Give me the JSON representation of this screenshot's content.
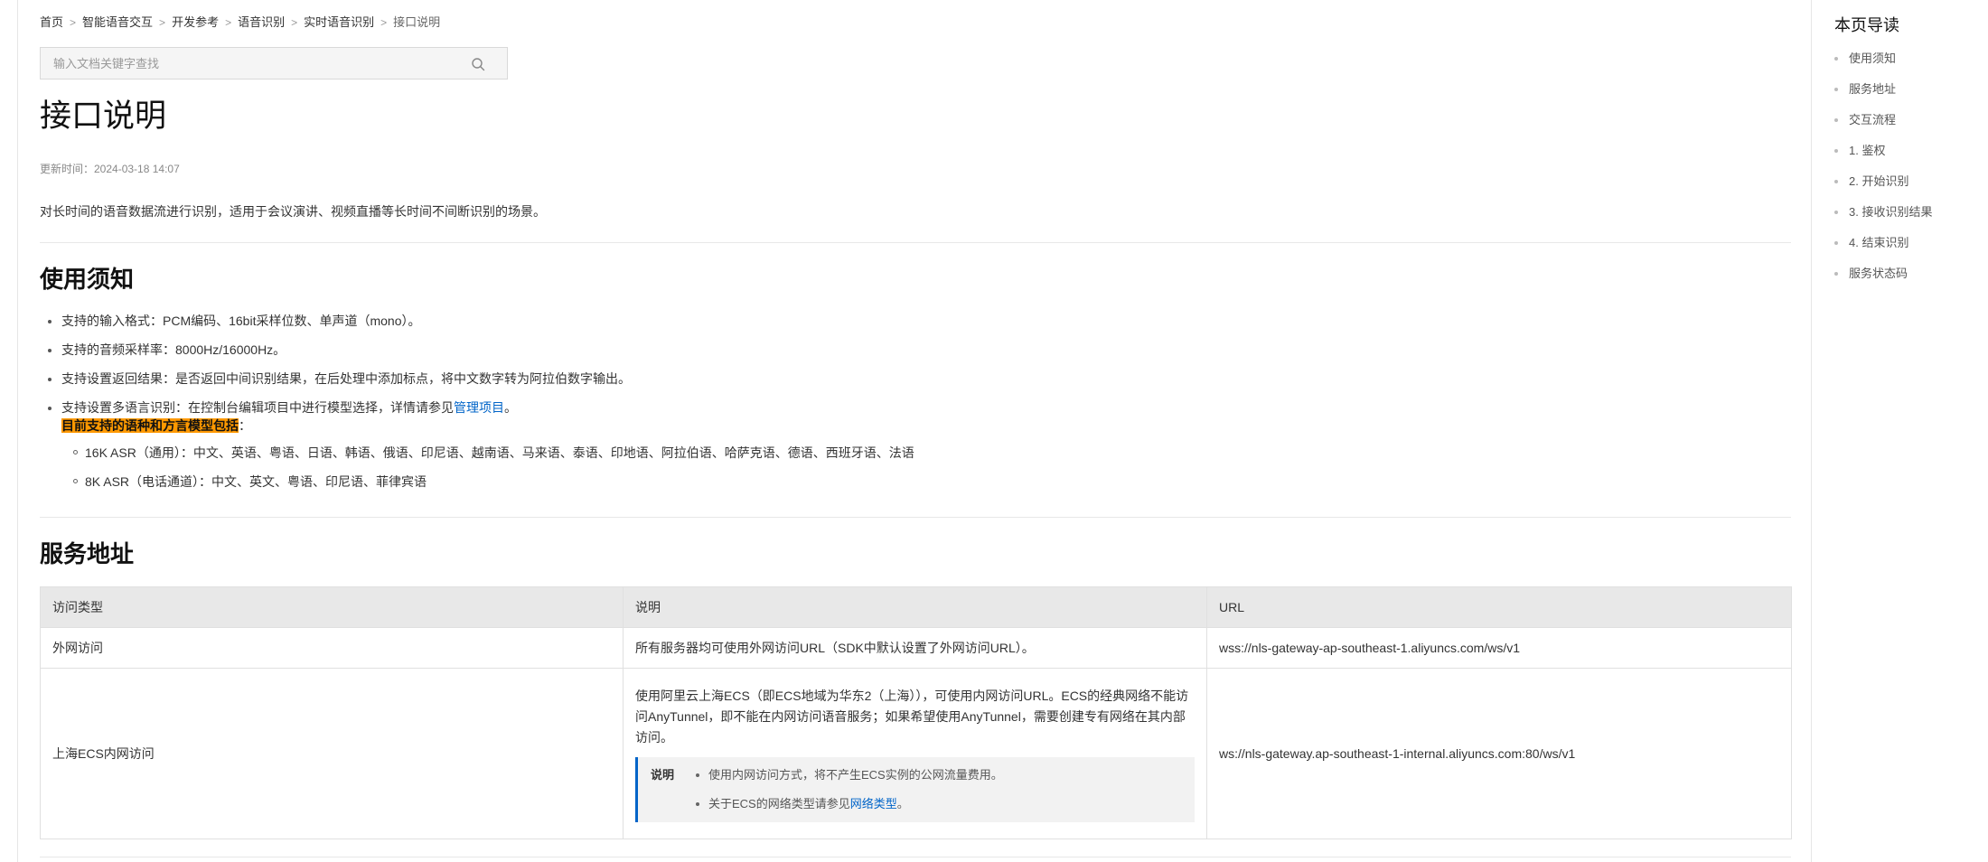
{
  "breadcrumb": [
    "首页",
    "智能语音交互",
    "开发参考",
    "语音识别",
    "实时语音识别",
    "接口说明"
  ],
  "search": {
    "placeholder": "输入文档关键字查找"
  },
  "page": {
    "title": "接口说明",
    "updated": "更新时间：2024-03-18 14:07",
    "intro": "对长时间的语音数据流进行识别，适用于会议演讲、视频直播等长时间不间断识别的场景。"
  },
  "usage": {
    "heading": "使用须知",
    "items": [
      "支持的输入格式：PCM编码、16bit采样位数、单声道（mono）。",
      "支持的音频采样率：8000Hz/16000Hz。",
      "支持设置返回结果：是否返回中间识别结果，在后处理中添加标点，将中文数字转为阿拉伯数字输出。"
    ],
    "multi": {
      "prefix": "支持设置多语言识别：在控制台编辑项目中进行模型选择，详情请参见",
      "link": "管理项目",
      "suffix": "。",
      "highlight": "目前支持的语种和方言模型包括",
      "colon": "：",
      "models": [
        "16K ASR（通用）：中文、英语、粤语、日语、韩语、俄语、印尼语、越南语、马来语、泰语、印地语、阿拉伯语、哈萨克语、德语、西班牙语、法语",
        "8K ASR（电话通道）：中文、英文、粤语、印尼语、菲律宾语"
      ]
    }
  },
  "service": {
    "heading": "服务地址",
    "columns": [
      "访问类型",
      "说明",
      "URL"
    ],
    "rows": [
      {
        "type": "外网访问",
        "desc": "所有服务器均可使用外网访问URL（SDK中默认设置了外网访问URL）。",
        "url": "wss://nls-gateway-ap-southeast-1.aliyuncs.com/ws/v1"
      },
      {
        "type": "上海ECS内网访问",
        "desc": "使用阿里云上海ECS（即ECS地域为华东2（上海）），可使用内网访问URL。ECS的经典网络不能访问AnyTunnel，即不能在内网访问语音服务；如果希望使用AnyTunnel，需要创建专有网络在其内部访问。",
        "note_label": "说明",
        "note_1": "使用内网访问方式，将不产生ECS实例的公网流量费用。",
        "note_2_prefix": "关于ECS的网络类型请参见",
        "note_2_link": "网络类型",
        "note_2_suffix": "。",
        "url": "ws://nls-gateway.ap-southeast-1-internal.aliyuncs.com:80/ws/v1"
      }
    ]
  },
  "toc": {
    "title": "本页导读",
    "items": [
      "使用须知",
      "服务地址",
      "交互流程",
      "1. 鉴权",
      "2. 开始识别",
      "3. 接收识别结果",
      "4. 结束识别",
      "服务状态码"
    ]
  },
  "colors": {
    "link": "#0064c8",
    "highlight": "#ff9900"
  },
  "icons": {
    "search": "search-icon"
  }
}
